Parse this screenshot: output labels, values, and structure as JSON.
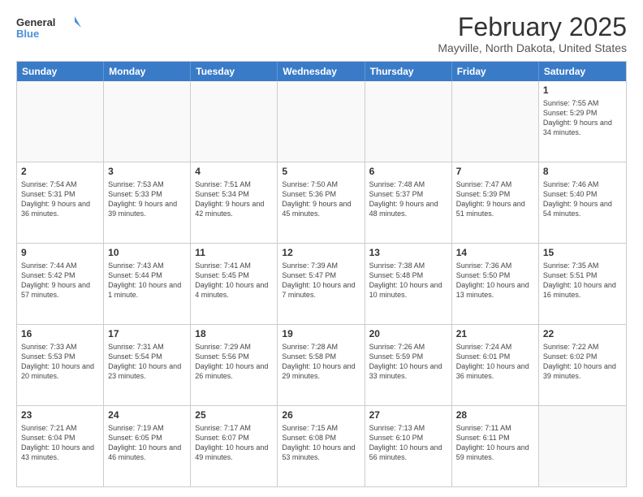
{
  "logo": {
    "line1": "General",
    "line2": "Blue",
    "icon_color": "#4a90d9"
  },
  "header": {
    "title": "February 2025",
    "subtitle": "Mayville, North Dakota, United States"
  },
  "weekdays": [
    "Sunday",
    "Monday",
    "Tuesday",
    "Wednesday",
    "Thursday",
    "Friday",
    "Saturday"
  ],
  "rows": [
    [
      {
        "day": "",
        "info": "",
        "empty": true
      },
      {
        "day": "",
        "info": "",
        "empty": true
      },
      {
        "day": "",
        "info": "",
        "empty": true
      },
      {
        "day": "",
        "info": "",
        "empty": true
      },
      {
        "day": "",
        "info": "",
        "empty": true
      },
      {
        "day": "",
        "info": "",
        "empty": true
      },
      {
        "day": "1",
        "info": "Sunrise: 7:55 AM\nSunset: 5:29 PM\nDaylight: 9 hours and 34 minutes.",
        "empty": false
      }
    ],
    [
      {
        "day": "2",
        "info": "Sunrise: 7:54 AM\nSunset: 5:31 PM\nDaylight: 9 hours and 36 minutes.",
        "empty": false
      },
      {
        "day": "3",
        "info": "Sunrise: 7:53 AM\nSunset: 5:33 PM\nDaylight: 9 hours and 39 minutes.",
        "empty": false
      },
      {
        "day": "4",
        "info": "Sunrise: 7:51 AM\nSunset: 5:34 PM\nDaylight: 9 hours and 42 minutes.",
        "empty": false
      },
      {
        "day": "5",
        "info": "Sunrise: 7:50 AM\nSunset: 5:36 PM\nDaylight: 9 hours and 45 minutes.",
        "empty": false
      },
      {
        "day": "6",
        "info": "Sunrise: 7:48 AM\nSunset: 5:37 PM\nDaylight: 9 hours and 48 minutes.",
        "empty": false
      },
      {
        "day": "7",
        "info": "Sunrise: 7:47 AM\nSunset: 5:39 PM\nDaylight: 9 hours and 51 minutes.",
        "empty": false
      },
      {
        "day": "8",
        "info": "Sunrise: 7:46 AM\nSunset: 5:40 PM\nDaylight: 9 hours and 54 minutes.",
        "empty": false
      }
    ],
    [
      {
        "day": "9",
        "info": "Sunrise: 7:44 AM\nSunset: 5:42 PM\nDaylight: 9 hours and 57 minutes.",
        "empty": false
      },
      {
        "day": "10",
        "info": "Sunrise: 7:43 AM\nSunset: 5:44 PM\nDaylight: 10 hours and 1 minute.",
        "empty": false
      },
      {
        "day": "11",
        "info": "Sunrise: 7:41 AM\nSunset: 5:45 PM\nDaylight: 10 hours and 4 minutes.",
        "empty": false
      },
      {
        "day": "12",
        "info": "Sunrise: 7:39 AM\nSunset: 5:47 PM\nDaylight: 10 hours and 7 minutes.",
        "empty": false
      },
      {
        "day": "13",
        "info": "Sunrise: 7:38 AM\nSunset: 5:48 PM\nDaylight: 10 hours and 10 minutes.",
        "empty": false
      },
      {
        "day": "14",
        "info": "Sunrise: 7:36 AM\nSunset: 5:50 PM\nDaylight: 10 hours and 13 minutes.",
        "empty": false
      },
      {
        "day": "15",
        "info": "Sunrise: 7:35 AM\nSunset: 5:51 PM\nDaylight: 10 hours and 16 minutes.",
        "empty": false
      }
    ],
    [
      {
        "day": "16",
        "info": "Sunrise: 7:33 AM\nSunset: 5:53 PM\nDaylight: 10 hours and 20 minutes.",
        "empty": false
      },
      {
        "day": "17",
        "info": "Sunrise: 7:31 AM\nSunset: 5:54 PM\nDaylight: 10 hours and 23 minutes.",
        "empty": false
      },
      {
        "day": "18",
        "info": "Sunrise: 7:29 AM\nSunset: 5:56 PM\nDaylight: 10 hours and 26 minutes.",
        "empty": false
      },
      {
        "day": "19",
        "info": "Sunrise: 7:28 AM\nSunset: 5:58 PM\nDaylight: 10 hours and 29 minutes.",
        "empty": false
      },
      {
        "day": "20",
        "info": "Sunrise: 7:26 AM\nSunset: 5:59 PM\nDaylight: 10 hours and 33 minutes.",
        "empty": false
      },
      {
        "day": "21",
        "info": "Sunrise: 7:24 AM\nSunset: 6:01 PM\nDaylight: 10 hours and 36 minutes.",
        "empty": false
      },
      {
        "day": "22",
        "info": "Sunrise: 7:22 AM\nSunset: 6:02 PM\nDaylight: 10 hours and 39 minutes.",
        "empty": false
      }
    ],
    [
      {
        "day": "23",
        "info": "Sunrise: 7:21 AM\nSunset: 6:04 PM\nDaylight: 10 hours and 43 minutes.",
        "empty": false
      },
      {
        "day": "24",
        "info": "Sunrise: 7:19 AM\nSunset: 6:05 PM\nDaylight: 10 hours and 46 minutes.",
        "empty": false
      },
      {
        "day": "25",
        "info": "Sunrise: 7:17 AM\nSunset: 6:07 PM\nDaylight: 10 hours and 49 minutes.",
        "empty": false
      },
      {
        "day": "26",
        "info": "Sunrise: 7:15 AM\nSunset: 6:08 PM\nDaylight: 10 hours and 53 minutes.",
        "empty": false
      },
      {
        "day": "27",
        "info": "Sunrise: 7:13 AM\nSunset: 6:10 PM\nDaylight: 10 hours and 56 minutes.",
        "empty": false
      },
      {
        "day": "28",
        "info": "Sunrise: 7:11 AM\nSunset: 6:11 PM\nDaylight: 10 hours and 59 minutes.",
        "empty": false
      },
      {
        "day": "",
        "info": "",
        "empty": true
      }
    ]
  ]
}
